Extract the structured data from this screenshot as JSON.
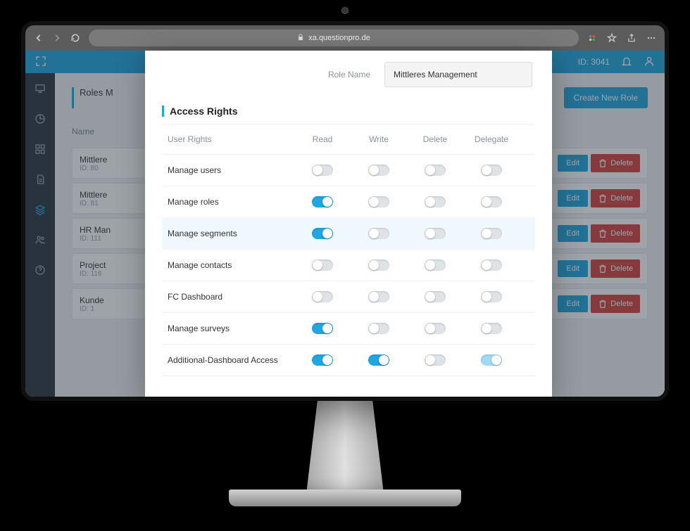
{
  "browser": {
    "url": "xa.questionpro.de"
  },
  "topbar": {
    "id_label": "ID: 3041"
  },
  "page": {
    "title": "Roles M",
    "create_button": "Create New Role",
    "columns": {
      "name": "Name"
    },
    "edit": "Edit",
    "delete": "Delete",
    "roles": [
      {
        "name": "Mittlere",
        "id": "ID: 80"
      },
      {
        "name": "Mittlere",
        "id": "ID: 81"
      },
      {
        "name": "HR Man",
        "id": "ID: 111"
      },
      {
        "name": "Project",
        "id": "ID: 116"
      },
      {
        "name": "Kunde",
        "id": "ID: 1"
      }
    ]
  },
  "dialog": {
    "role_name_label": "Role Name",
    "role_name_value": "Mittleres Management",
    "section_title": "Access Rights",
    "headers": {
      "rights": "User Rights",
      "read": "Read",
      "write": "Write",
      "delete": "Delete",
      "delegate": "Delegate"
    },
    "rows": [
      {
        "label": "Manage users",
        "read": false,
        "write": false,
        "delete": false,
        "delegate": false,
        "hl": false
      },
      {
        "label": "Manage roles",
        "read": true,
        "write": false,
        "delete": false,
        "delegate": false,
        "hl": false
      },
      {
        "label": "Manage segments",
        "read": true,
        "write": false,
        "delete": false,
        "delegate": false,
        "hl": true
      },
      {
        "label": "Manage contacts",
        "read": false,
        "write": false,
        "delete": false,
        "delegate": false,
        "hl": false
      },
      {
        "label": "FC Dashboard",
        "read": false,
        "write": false,
        "delete": false,
        "delegate": false,
        "hl": false
      },
      {
        "label": "Manage surveys",
        "read": true,
        "write": false,
        "delete": false,
        "delegate": false,
        "hl": false
      },
      {
        "label": "Additional-Dashboard Access",
        "read": true,
        "write": true,
        "delete": false,
        "delegate": "light",
        "hl": false
      }
    ]
  }
}
